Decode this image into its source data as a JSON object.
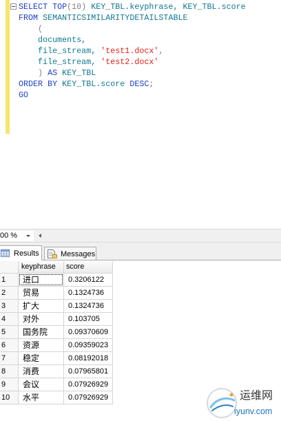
{
  "editor": {
    "change_margin_color": "#f6e56b",
    "collapse_icon": "collapse-minus-icon",
    "lines": [
      {
        "tokens": [
          {
            "text": "SELECT TOP",
            "color": "#1c3fc8"
          },
          {
            "text": "(10)",
            "color": "#808080"
          },
          {
            "text": " KEY_TBL.keyphrase, KEY_TBL.score",
            "color": "#0f7892"
          }
        ]
      },
      {
        "tokens": [
          {
            "text": "FROM",
            "color": "#1c3fc8"
          },
          {
            "text": " SEMANTICSIMILARITYDETAILSTABLE",
            "color": "#0f7892"
          }
        ]
      },
      {
        "tokens": [
          {
            "text": "    (",
            "color": "#808080"
          }
        ]
      },
      {
        "tokens": [
          {
            "text": "    documents,",
            "color": "#0f7892"
          }
        ]
      },
      {
        "tokens": [
          {
            "text": "    file_stream, ",
            "color": "#0f7892"
          },
          {
            "text": "'test1.docx'",
            "color": "#e0201a"
          },
          {
            "text": ",",
            "color": "#808080"
          }
        ]
      },
      {
        "tokens": [
          {
            "text": "    file_stream, ",
            "color": "#0f7892"
          },
          {
            "text": "'test2.docx'",
            "color": "#e0201a"
          }
        ]
      },
      {
        "tokens": [
          {
            "text": "    ) ",
            "color": "#808080"
          },
          {
            "text": "AS",
            "color": "#1c3fc8"
          },
          {
            "text": " KEY_TBL",
            "color": "#0f7892"
          }
        ]
      },
      {
        "tokens": [
          {
            "text": "ORDER BY",
            "color": "#1c3fc8"
          },
          {
            "text": " KEY_TBL.score ",
            "color": "#0f7892"
          },
          {
            "text": "DESC",
            "color": "#1c3fc8"
          },
          {
            "text": ";",
            "color": "#808080"
          }
        ]
      },
      {
        "tokens": [
          {
            "text": "GO",
            "color": "#1c3fc8"
          }
        ]
      }
    ]
  },
  "zoom": {
    "value": "00 %",
    "dropdown_icon": "chevron-down-icon",
    "scroll_icon": "scroll-left-icon"
  },
  "results_pane": {
    "tabs": [
      {
        "label": "Results",
        "icon": "grid-icon"
      },
      {
        "label": "Messages",
        "icon": "messages-icon"
      }
    ],
    "columns": [
      "keyphrase",
      "score"
    ],
    "rows": [
      {
        "row_number": 1,
        "keyphrase": "进口",
        "score": "0.3206122"
      },
      {
        "row_number": 2,
        "keyphrase": "贸易",
        "score": "0.1324736"
      },
      {
        "row_number": 3,
        "keyphrase": "扩大",
        "score": "0.1324736"
      },
      {
        "row_number": 4,
        "keyphrase": "对外",
        "score": "0.103705"
      },
      {
        "row_number": 5,
        "keyphrase": "国务院",
        "score": "0.09370609"
      },
      {
        "row_number": 6,
        "keyphrase": "资源",
        "score": "0.09359023"
      },
      {
        "row_number": 7,
        "keyphrase": "稳定",
        "score": "0.08192018"
      },
      {
        "row_number": 8,
        "keyphrase": "消费",
        "score": "0.07965801"
      },
      {
        "row_number": 9,
        "keyphrase": "会议",
        "score": "0.07926929"
      },
      {
        "row_number": 10,
        "keyphrase": "水平",
        "score": "0.07926929"
      }
    ],
    "selected_cell": {
      "row_index": 0,
      "column_index": 1
    }
  },
  "watermark": {
    "name": "运维网",
    "domain": "iyunv.com",
    "logo_icon": "site-logo-icon"
  }
}
